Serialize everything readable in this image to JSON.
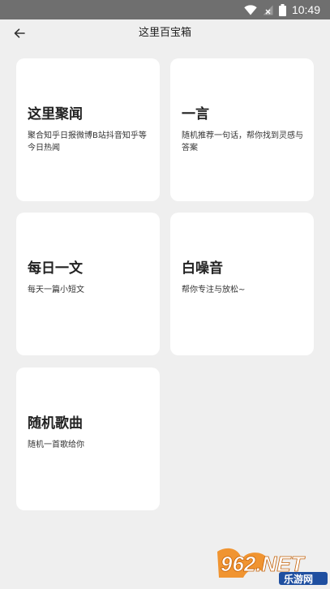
{
  "status_bar": {
    "time": "10:49",
    "icons": [
      "wifi-icon",
      "signal-off-icon",
      "battery-icon"
    ]
  },
  "header": {
    "title": "这里百宝箱",
    "back_icon": "arrow-left-icon"
  },
  "cards": [
    {
      "title": "这里聚闻",
      "desc": "聚合知乎日报微博B站抖音知乎等今日热闻"
    },
    {
      "title": "一言",
      "desc": "随机推荐一句话，帮你找到灵感与答案"
    },
    {
      "title": "每日一文",
      "desc": "每天一篇小短文"
    },
    {
      "title": "白噪音",
      "desc": "帮你专注与放松~"
    },
    {
      "title": "随机歌曲",
      "desc": "随机一首歌给你"
    }
  ],
  "watermark": {
    "brand": "962.NET",
    "sub": "乐游网"
  },
  "colors": {
    "background": "#efefef",
    "status_bar": "#6f6f6f",
    "card": "#ffffff",
    "watermark_orange": "#f08a1c",
    "watermark_blue": "#1f4fa0"
  }
}
